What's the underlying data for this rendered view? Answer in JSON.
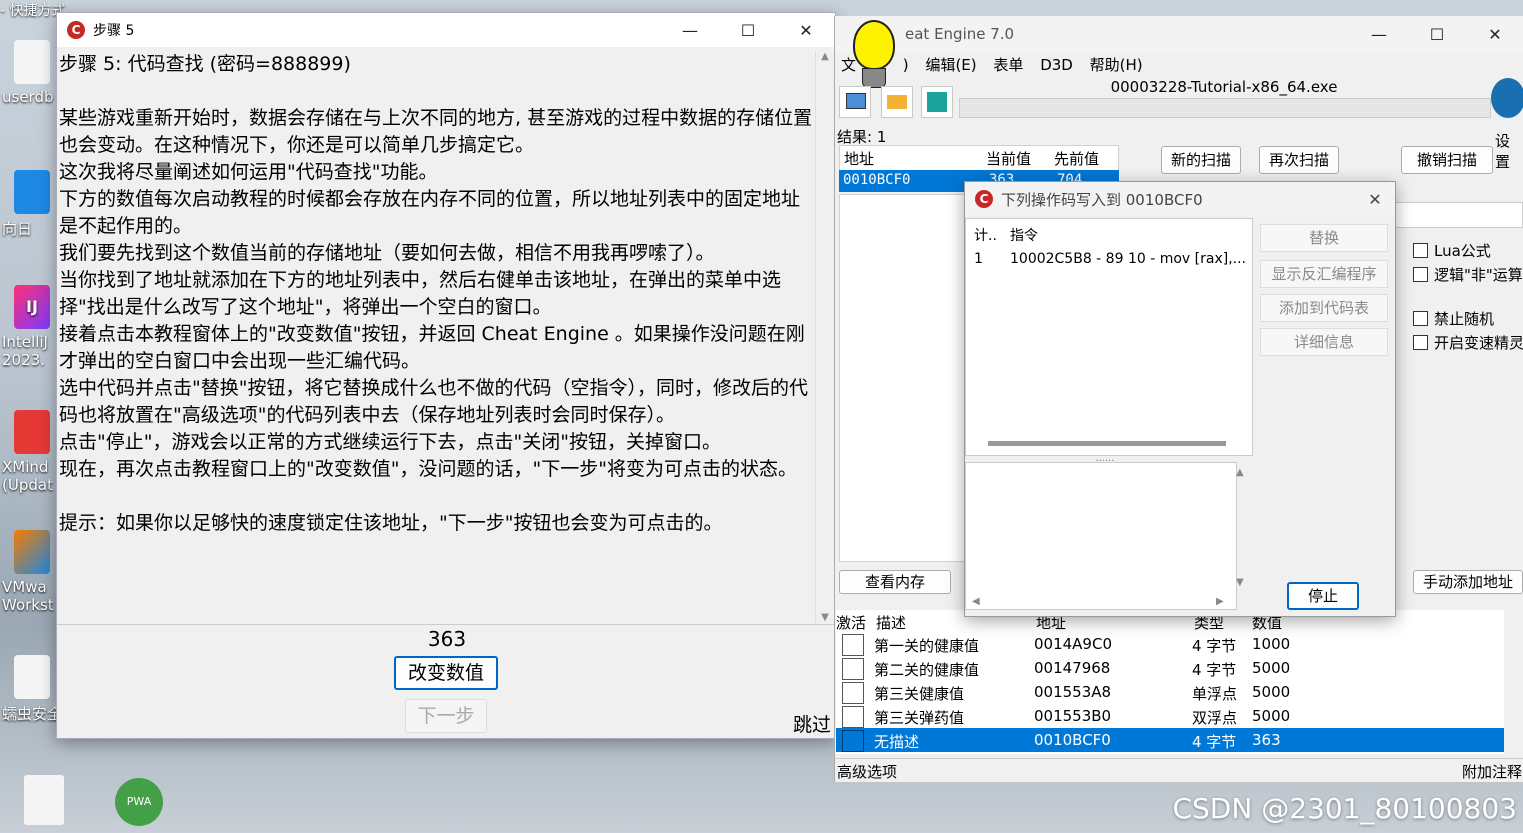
{
  "desktop": {
    "top_label": "- 快捷方式",
    "icons": [
      {
        "label": "userdb"
      },
      {
        "label": "向日"
      },
      {
        "label": "IntelliJ"
      },
      {
        "label": "2023."
      },
      {
        "label": "XMind"
      },
      {
        "label": "(Updat"
      },
      {
        "label": "VMwa"
      },
      {
        "label": "Workst"
      },
      {
        "label": "蠕虫安全"
      }
    ],
    "pwa_badge": "PWA",
    "ij_badge": "IJ"
  },
  "tutorial": {
    "title": "步骤 5",
    "body": "步骤 5: 代码查找 (密码=888899)\n\n某些游戏重新开始时，数据会存储在与上次不同的地方, 甚至游戏的过程中数据的存储位置也会变动。在这种情况下，你还是可以简单几步搞定它。\n这次我将尽量阐述如何运用\"代码查找\"功能。\n下方的数值每次启动教程的时候都会存放在内存不同的位置，所以地址列表中的固定地址是不起作用的。\n我们要先找到这个数值当前的存储地址（要如何去做，相信不用我再啰嗦了）。\n当你找到了地址就添加在下方的地址列表中，然后右健单击该地址，在弹出的菜单中选择\"找出是什么改写了这个地址\"，将弹出一个空白的窗口。\n接着点击本教程窗体上的\"改变数值\"按钮，并返回 Cheat Engine 。如果操作没问题在刚才弹出的空白窗口中会出现一些汇编代码。\n选中代码并点击\"替换\"按钮，将它替换成什么也不做的代码（空指令），同时，修改后的代码也将放置在\"高级选项\"的代码列表中去（保存地址列表时会同时保存）。\n点击\"停止\"，游戏会以正常的方式继续运行下去，点击\"关闭\"按钮，关掉窗口。\n现在，再次点击教程窗口上的\"改变数值\"，没问题的话，\"下一步\"将变为可点击的状态。\n\n提示：如果你以足够快的速度锁定住该地址，\"下一步\"按钮也会变为可点击的。",
    "value": "363",
    "change_button": "改变数值",
    "next_button": "下一步",
    "skip_label": "跳过"
  },
  "ce": {
    "title": "Cheat Engine 7.0",
    "title_visible": "eat Engine 7.0",
    "menu": [
      "文",
      ")",
      "编辑(E)",
      "表单",
      "D3D",
      "帮助(H)"
    ],
    "process": "00003228-Tutorial-x86_64.exe",
    "settings_label": "设置",
    "results": "结果: 1",
    "result_headers": [
      "地址",
      "当前值",
      "先前值"
    ],
    "result_row": {
      "address": "0010BCF0",
      "current": "363",
      "previous": "704"
    },
    "new_scan": "新的扫描",
    "next_scan": "再次扫描",
    "undo_scan": "撤销扫描",
    "options": [
      "Lua公式",
      "逻辑\"非\"运算",
      "禁止随机",
      "开启变速精灵"
    ],
    "view_memory": "查看内存",
    "add_address": "手动添加地址",
    "table_headers": [
      "激活",
      "描述",
      "地址",
      "类型",
      "数值"
    ],
    "table_rows": [
      {
        "desc": "第一关的健康值",
        "address": "0014A9C0",
        "type": "4 字节",
        "value": "1000"
      },
      {
        "desc": "第二关的健康值",
        "address": "00147968",
        "type": "4 字节",
        "value": "5000"
      },
      {
        "desc": "第三关健康值",
        "address": "001553A8",
        "type": "单浮点",
        "value": "5000"
      },
      {
        "desc": "第三关弹药值",
        "address": "001553B0",
        "type": "双浮点",
        "value": "5000"
      },
      {
        "desc": "无描述",
        "address": "0010BCF0",
        "type": "4 字节",
        "value": "363"
      }
    ],
    "advanced": "高级选项",
    "comments": "附加注释"
  },
  "dialog": {
    "title": "下列操作码写入到 0010BCF0",
    "headers": [
      "计..",
      "指令"
    ],
    "row": {
      "count": "1",
      "instruction": "10002C5B8 - 89 10  - mov [rax],..."
    },
    "buttons": [
      "替换",
      "显示反汇编程序",
      "添加到代码表",
      "详细信息"
    ],
    "stop": "停止"
  },
  "watermark": "CSDN @2301_80100803",
  "colors": {
    "selection": "#0078d7",
    "ce_red": "#c62828"
  }
}
